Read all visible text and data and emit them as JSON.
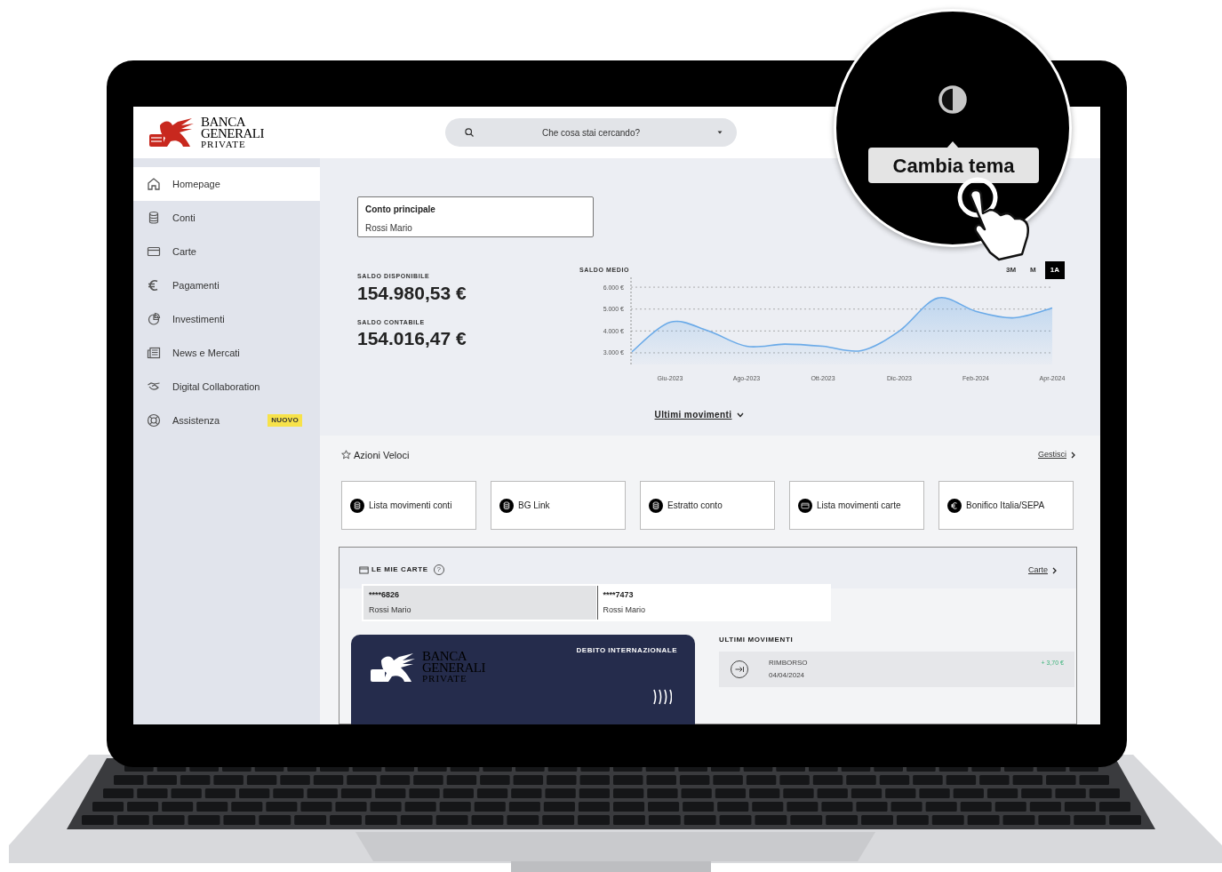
{
  "header": {
    "logo": [
      "BANCA",
      "GENERALI",
      "PRIVATE"
    ],
    "search": {
      "placeholder": "Che cosa stai cercando?"
    }
  },
  "sidebar": {
    "items": [
      {
        "label": "Homepage",
        "kind": "home",
        "selected": true
      },
      {
        "label": "Conti",
        "kind": "coins",
        "selected": false
      },
      {
        "label": "Carte",
        "kind": "card",
        "selected": false
      },
      {
        "label": "Pagamenti",
        "kind": "euro",
        "selected": false
      },
      {
        "label": "Investimenti",
        "kind": "pie",
        "selected": false
      },
      {
        "label": "News e Mercati",
        "kind": "news",
        "selected": false
      },
      {
        "label": "Digital Collaboration",
        "kind": "handshake",
        "selected": false
      },
      {
        "label": "Assistenza",
        "kind": "lifebuoy",
        "selected": false,
        "badge": "NUOVO"
      }
    ]
  },
  "account": {
    "title": "Conto principale",
    "holder": "Rossi Mario"
  },
  "balances": [
    {
      "label": "SALDO DISPONIBILE",
      "value": "154.980,53 €"
    },
    {
      "label": "SALDO CONTABILE",
      "value": "154.016,47 €"
    }
  ],
  "chart": {
    "ranges": [
      {
        "label": "3M",
        "selected": false
      },
      {
        "label": "M",
        "selected": false
      },
      {
        "label": "1A",
        "selected": true
      }
    ],
    "chart_data": {
      "type": "area",
      "title": "SALDO MEDIO",
      "categories": [
        null,
        "Giu-2023",
        null,
        "Ago-2023",
        null,
        "Ott-2023",
        null,
        "Dic-2023",
        null,
        "Feb-2024",
        null,
        "Apr-2024"
      ],
      "series": [
        {
          "color": "#6aaae8",
          "values": [
            3050,
            4400,
            4000,
            3300,
            3400,
            3300,
            3100,
            4000,
            5500,
            4900,
            4600,
            5050
          ]
        }
      ],
      "yticks": [
        {
          "value": 3000,
          "label": "3.000 €"
        },
        {
          "value": 4000,
          "label": "4.000 €"
        },
        {
          "value": 5000,
          "label": "5.000 €"
        },
        {
          "value": 6000,
          "label": "6.000 €"
        }
      ],
      "ylim": [
        2470,
        6450
      ],
      "grid": true
    }
  },
  "movements_link": "Ultimi movimenti",
  "quick_actions": {
    "title": "Azioni Veloci",
    "manage": "Gestisci",
    "items": [
      {
        "label": "Lista movimenti conti",
        "kind": "coins"
      },
      {
        "label": "BG Link",
        "kind": "coins"
      },
      {
        "label": "Estratto conto",
        "kind": "coins"
      },
      {
        "label": "Lista movimenti carte",
        "kind": "card"
      },
      {
        "label": "Bonifico Italia/SEPA",
        "kind": "euro"
      }
    ]
  },
  "cards": {
    "title": "LE MIE CARTE",
    "help": "?",
    "link": "Carte",
    "tabs": [
      {
        "number": "****6826",
        "holder": "Rossi Mario",
        "selected": true
      },
      {
        "number": "****7473",
        "holder": "Rossi Mario",
        "selected": false
      }
    ],
    "card": {
      "logo": [
        "BANCA",
        "GENERALI",
        "PRIVATE"
      ],
      "type": "DEBITO INTERNAZIONALE"
    },
    "movements": {
      "title": "ULTIMI MOVIMENTI",
      "items": [
        {
          "label": "RIMBORSO",
          "date": "04/04/2024",
          "amount": "+ 3,70 €"
        }
      ]
    }
  },
  "magnifier": {
    "tooltip": "Cambia tema"
  }
}
